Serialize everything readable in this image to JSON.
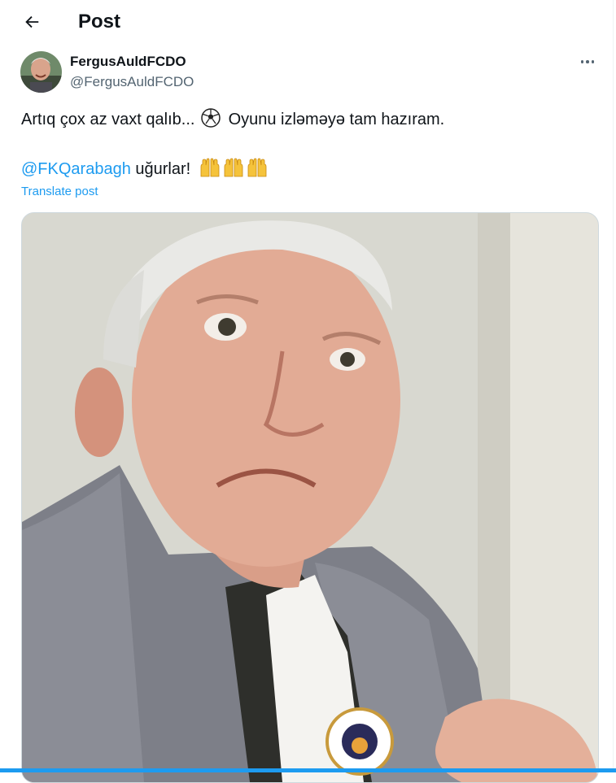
{
  "header": {
    "back_icon": "arrow-left-icon",
    "title": "Post"
  },
  "post": {
    "author": {
      "display_name": "FergusAuldFCDO",
      "handle": "@FergusAuldFCDO",
      "avatar": "avatar-photo"
    },
    "more_icon": "more-horizontal-icon",
    "text_line1_before": "Artıq çox az vaxt qalıb...",
    "text_line1_emoji": "soccer-ball-icon",
    "text_line1_after": "Oyunu izləməyə tam hazıram.",
    "mention": "@FKQarabagh",
    "text_line2_after": " uğurlar!",
    "text_line2_emoji": "raising-hands-icon x3",
    "translate_label": "Translate post",
    "media": "selfie-photo"
  },
  "colors": {
    "accent": "#1d9bf0",
    "secondary_text": "#536471",
    "text": "#0f1419"
  }
}
